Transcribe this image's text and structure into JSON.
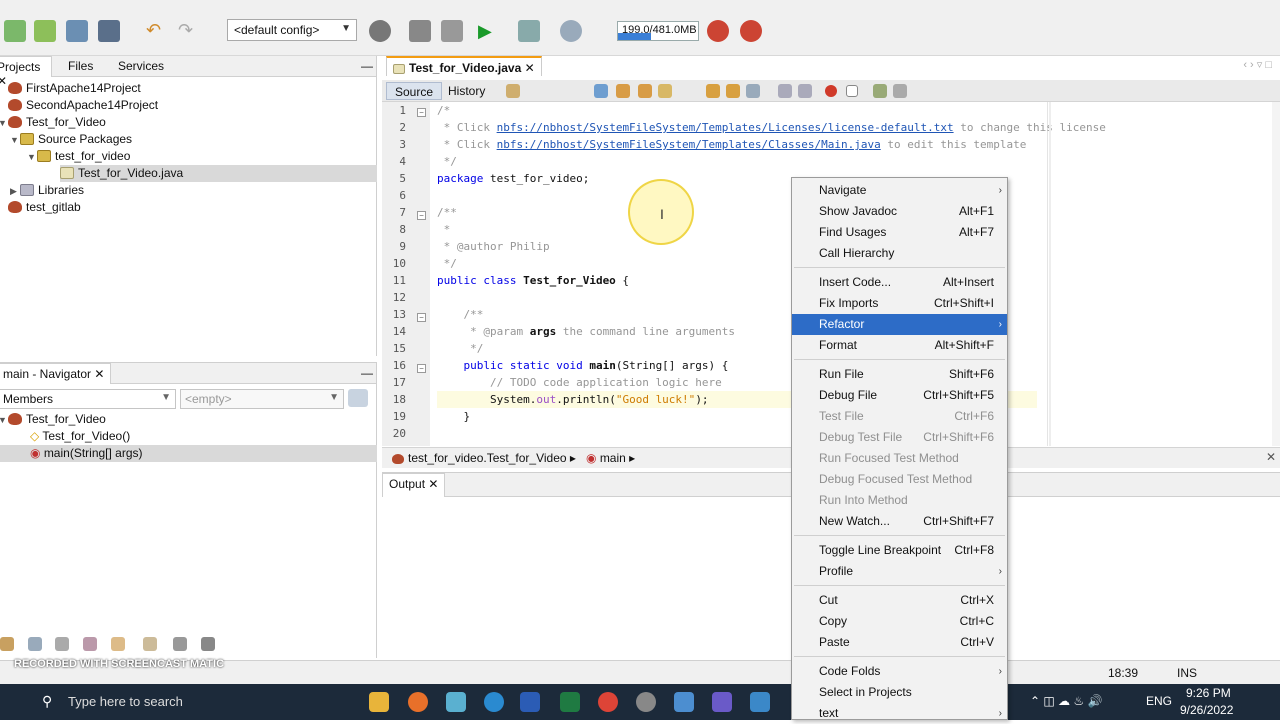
{
  "toolbar": {
    "config": "<default config>",
    "memory": "199.0/481.0MB",
    "memory_fraction": 0.41
  },
  "projects": {
    "tabs": [
      "Projects",
      "Files",
      "Services"
    ],
    "tree": [
      {
        "label": "FirstApache14Project",
        "icon": "project-icon"
      },
      {
        "label": "SecondApache14Project",
        "icon": "project-icon"
      },
      {
        "label": "Test_for_Video",
        "icon": "project-icon"
      },
      {
        "label": "Source Packages",
        "icon": "package-icon"
      },
      {
        "label": "test_for_video",
        "icon": "package-icon"
      },
      {
        "label": "Test_for_Video.java",
        "icon": "java-file-icon"
      },
      {
        "label": "Libraries",
        "icon": "library-icon"
      },
      {
        "label": "test_gitlab",
        "icon": "project-icon"
      }
    ]
  },
  "navigator": {
    "title": "main - Navigator",
    "members_label": "Members",
    "filter_placeholder": "<empty>",
    "items": [
      "Test_for_Video",
      "Test_for_Video()",
      "main(String[] args)"
    ]
  },
  "editor": {
    "tab": "Test_for_Video.java",
    "source_tab": "Source",
    "history_tab": "History",
    "lines": [
      "1",
      "2",
      "3",
      "4",
      "5",
      "6",
      "7",
      "8",
      "9",
      "10",
      "11",
      "12",
      "13",
      "14",
      "15",
      "16",
      "17",
      "18",
      "19",
      "20"
    ],
    "code": {
      "l1": "/*",
      "l2a": " * Click ",
      "l2b": "nbfs://nbhost/SystemFileSystem/Templates/Licenses/license-default.txt",
      "l2c": " to change this license",
      "l3a": " * Click ",
      "l3b": "nbfs://nbhost/SystemFileSystem/Templates/Classes/Main.java",
      "l3c": " to edit this template",
      "l4": " */",
      "l5a": "package",
      "l5b": " test_for_video;",
      "l7": "/**",
      "l8": " *",
      "l9": " * @author Philip",
      "l10": " */",
      "l11a": "public class ",
      "l11b": "Test_for_Video",
      "l11c": " {",
      "l13": "    /**",
      "l14a": "     * @param ",
      "l14b": "args",
      "l14c": " the command line arguments",
      "l15": "     */",
      "l16a": "    public static void ",
      "l16b": "main",
      "l16c": "(String[] args) {",
      "l17": "        // TODO code application logic here",
      "l18a": "        System.",
      "l18b": "out",
      "l18c": ".println(",
      "l18d": "\"Good luck!\"",
      "l18e": ");",
      "l19": "    }"
    },
    "breadcrumb": [
      "test_for_video.Test_for_Video",
      "main"
    ]
  },
  "output": {
    "tab": "Output"
  },
  "status": {
    "position": "18:39",
    "mode": "INS"
  },
  "taskbar": {
    "search": "Type here to search",
    "time": "9:26 PM",
    "date": "9/26/2022",
    "lang": "ENG"
  },
  "watermark": "RECORDED WITH SCREENCAST MATIC",
  "context_menu": [
    {
      "label": "Navigate",
      "shortcut": "",
      "submenu": true,
      "state": "normal"
    },
    {
      "label": "Show Javadoc",
      "shortcut": "Alt+F1",
      "submenu": false,
      "state": "normal"
    },
    {
      "label": "Find Usages",
      "shortcut": "Alt+F7",
      "submenu": false,
      "state": "normal"
    },
    {
      "label": "Call Hierarchy",
      "shortcut": "",
      "submenu": false,
      "state": "normal"
    },
    {
      "label": "Insert Code...",
      "shortcut": "Alt+Insert",
      "submenu": false,
      "state": "normal"
    },
    {
      "label": "Fix Imports",
      "shortcut": "Ctrl+Shift+I",
      "submenu": false,
      "state": "normal"
    },
    {
      "label": "Refactor",
      "shortcut": "",
      "submenu": true,
      "state": "selected"
    },
    {
      "label": "Format",
      "shortcut": "Alt+Shift+F",
      "submenu": false,
      "state": "normal"
    },
    {
      "label": "Run File",
      "shortcut": "Shift+F6",
      "submenu": false,
      "state": "normal"
    },
    {
      "label": "Debug File",
      "shortcut": "Ctrl+Shift+F5",
      "submenu": false,
      "state": "normal"
    },
    {
      "label": "Test File",
      "shortcut": "Ctrl+F6",
      "submenu": false,
      "state": "disabled"
    },
    {
      "label": "Debug Test File",
      "shortcut": "Ctrl+Shift+F6",
      "submenu": false,
      "state": "disabled"
    },
    {
      "label": "Run Focused Test Method",
      "shortcut": "",
      "submenu": false,
      "state": "disabled"
    },
    {
      "label": "Debug Focused Test Method",
      "shortcut": "",
      "submenu": false,
      "state": "disabled"
    },
    {
      "label": "Run Into Method",
      "shortcut": "",
      "submenu": false,
      "state": "disabled"
    },
    {
      "label": "New Watch...",
      "shortcut": "Ctrl+Shift+F7",
      "submenu": false,
      "state": "normal"
    },
    {
      "label": "Toggle Line Breakpoint",
      "shortcut": "Ctrl+F8",
      "submenu": false,
      "state": "normal"
    },
    {
      "label": "Profile",
      "shortcut": "",
      "submenu": true,
      "state": "normal"
    },
    {
      "label": "Cut",
      "shortcut": "Ctrl+X",
      "submenu": false,
      "state": "normal"
    },
    {
      "label": "Copy",
      "shortcut": "Ctrl+C",
      "submenu": false,
      "state": "normal"
    },
    {
      "label": "Paste",
      "shortcut": "Ctrl+V",
      "submenu": false,
      "state": "normal"
    },
    {
      "label": "Code Folds",
      "shortcut": "",
      "submenu": true,
      "state": "normal"
    },
    {
      "label": "Select in Projects",
      "shortcut": "",
      "submenu": false,
      "state": "normal"
    },
    {
      "label": "text",
      "shortcut": "",
      "submenu": true,
      "state": "normal"
    }
  ],
  "colors": {
    "accent": "#2d6cc7",
    "tab_marker": "#f39c12",
    "memory_bar": "#3b7fd6"
  }
}
